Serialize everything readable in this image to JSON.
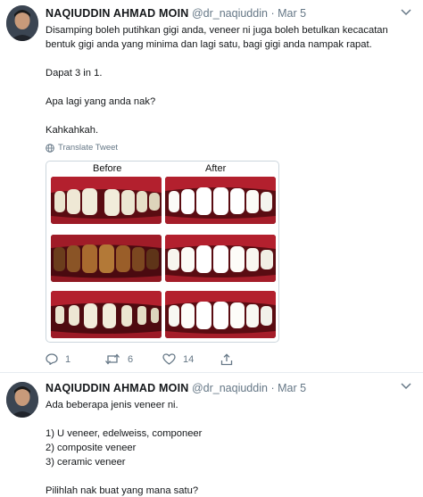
{
  "tweets": [
    {
      "name": "NAQIUDDIN AHMAD MOIN",
      "handle": "@dr_naqiuddin",
      "separator": "·",
      "date": "Mar 5",
      "lines": [
        "Disamping boleh putihkan gigi anda, veneer ni juga boleh betulkan kecacatan",
        "bentuk gigi anda yang minima dan lagi satu, bagi gigi anda nampak rapat.",
        "",
        "Dapat 3 in 1.",
        "",
        "Apa lagi yang anda nak?",
        "",
        "Kahkahkah."
      ],
      "translate_label": "Translate Tweet",
      "media": {
        "before_label": "Before",
        "after_label": "After"
      },
      "actions": {
        "reply_count": "1",
        "retweet_count": "6",
        "like_count": "14"
      }
    },
    {
      "name": "NAQIUDDIN AHMAD MOIN",
      "handle": "@dr_naqiuddin",
      "separator": "·",
      "date": "Mar 5",
      "lines": [
        "Ada beberapa jenis veneer ni.",
        "",
        "1) U veneer, edelweiss, componeer",
        "2) composite veneer",
        "3) ceramic veneer",
        "",
        "Pilihlah nak buat yang mana satu?"
      ]
    }
  ],
  "icons": [
    "avatar",
    "caret-down-icon",
    "globe-icon",
    "reply-icon",
    "retweet-icon",
    "like-icon",
    "share-icon"
  ],
  "colors": {
    "text": "#14171a",
    "secondary": "#657786",
    "border": "#e6ecf0",
    "gum": "#b3202e",
    "stained_teeth": "#6b3d1c"
  }
}
